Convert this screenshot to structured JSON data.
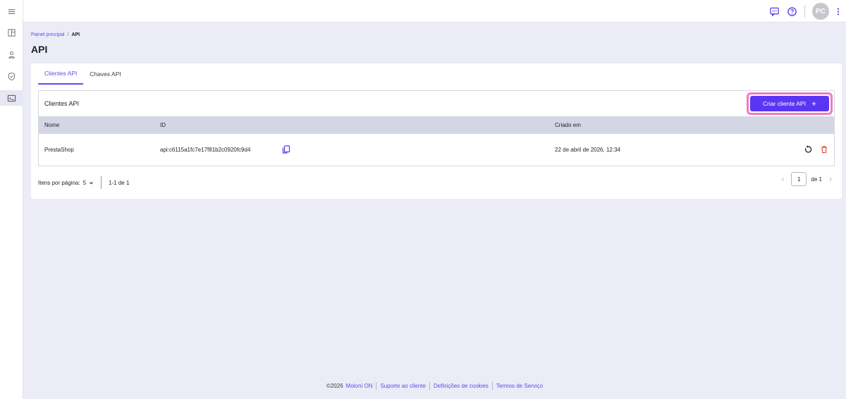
{
  "breadcrumb": {
    "home": "Painel principal",
    "separator": "/",
    "current": "API"
  },
  "page": {
    "title": "API"
  },
  "tabs": [
    {
      "label": "Clientes API",
      "active": true
    },
    {
      "label": "Chaves API",
      "active": false
    }
  ],
  "panel": {
    "title": "Clientes API",
    "create_label": "Criar cliente API",
    "create_icon": "plus-icon"
  },
  "table": {
    "columns": [
      "Nome",
      "ID",
      "Criado em"
    ],
    "rows": [
      {
        "name": "PrestaShop",
        "id": "api:c6115a1fc7e17f81b2c0920fc9d4",
        "created": "22 de abril de 2026, 12:34"
      }
    ]
  },
  "pager": {
    "items_label": "Itens por página:",
    "items_value": "5",
    "range": "1-1 de 1",
    "page": "1",
    "of": "de 1"
  },
  "footer": {
    "copyright": "©2026",
    "brand": "Moloni ON",
    "links": [
      "Suporte ao cliente",
      "Definições de cookies",
      "Termos de Serviço"
    ]
  },
  "user": {
    "initials": "PC"
  },
  "colors": {
    "accent": "#5b36f2",
    "highlight_ring": "#f07ac6",
    "delete": "#e53935"
  }
}
